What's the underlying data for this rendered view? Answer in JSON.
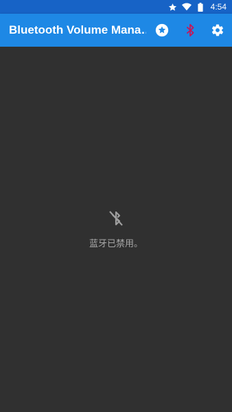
{
  "status_bar": {
    "time": "4:54",
    "icons": [
      "star-icon",
      "wifi-icon",
      "battery-icon"
    ]
  },
  "app_bar": {
    "title": "Bluetooth Volume Mana…",
    "actions": [
      "star-circle-icon",
      "bluetooth-icon",
      "gear-icon"
    ]
  },
  "empty_state": {
    "icon": "bluetooth-disabled-icon",
    "message": "蓝牙已禁用。"
  },
  "colors": {
    "status_bar": "#1763c6",
    "app_bar": "#1e88e5",
    "background": "#303030",
    "bluetooth_action": "#c2185b",
    "empty_text": "#a8a8a8"
  }
}
